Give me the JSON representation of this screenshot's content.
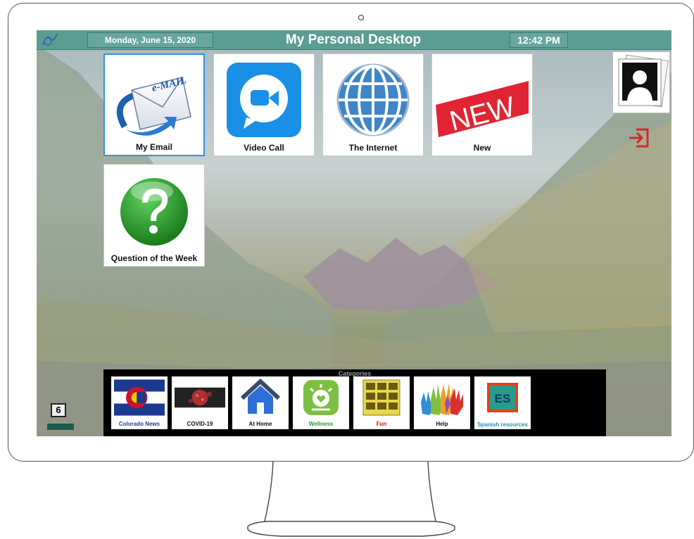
{
  "header": {
    "date": "Monday, June 15, 2020",
    "title": "My Personal Desktop",
    "time": "12:42 PM"
  },
  "tiles": [
    {
      "label": "My Email"
    },
    {
      "label": "Video Call"
    },
    {
      "label": "The Internet"
    },
    {
      "label": "New",
      "badge": "NEW"
    },
    {
      "label": "Question of the Week"
    }
  ],
  "email_icon_text": "e-MAIL",
  "categories": {
    "title": "Categories",
    "items": [
      {
        "label": "Colorado News",
        "color": "#1a3fa0"
      },
      {
        "label": "COVID-19",
        "color": "#111111"
      },
      {
        "label": "At Home",
        "color": "#111111"
      },
      {
        "label": "Wellness",
        "color": "#2e9b2e"
      },
      {
        "label": "Fun",
        "color": "#e01010"
      },
      {
        "label": "Help",
        "color": "#111111"
      },
      {
        "label": "Spanish resources",
        "color": "#2a8fb0",
        "badge": "ES"
      }
    ]
  },
  "mini_button": "6",
  "colors": {
    "header": "#5b9c93",
    "accent_select": "#3b8fdc",
    "exit": "#d12a2a"
  },
  "icons": [
    "logo-icon",
    "email-icon",
    "video-call-icon",
    "globe-icon",
    "new-banner-icon",
    "question-icon",
    "profile-photo-icon",
    "exit-icon"
  ]
}
